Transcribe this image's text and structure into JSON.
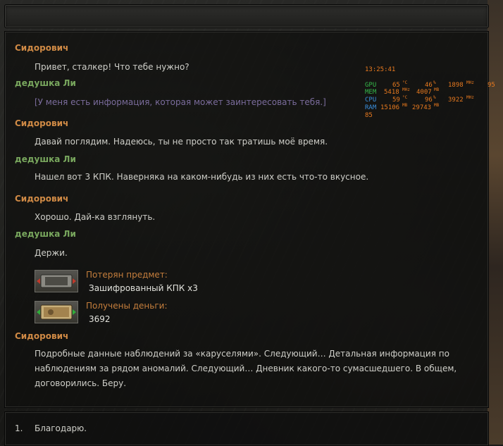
{
  "dialog": {
    "messages": [
      {
        "speaker": "Сидорович",
        "text": "Привет, сталкер! Что тебе нужно?"
      },
      {
        "speaker": "дедушка Ли",
        "text": "[У меня есть информация, которая может заинтересовать тебя.]"
      },
      {
        "speaker": "Сидорович",
        "text": "Давай поглядим. Надеюсь, ты не просто так тратишь моё время."
      },
      {
        "speaker": "дедушка Ли",
        "text": "Нашел вот 3 КПК. Наверняка на каком-нибудь из них есть что-то вкусное."
      },
      {
        "speaker": "Сидорович",
        "text": "Хорошо. Дай-ка взглянуть."
      },
      {
        "speaker": "дедушка Ли",
        "text": "Держи."
      },
      {
        "speaker": "Сидорович",
        "text": "Подробные данные наблюдений за «каруселями». Следующий… Детальная информация по наблюдениям за рядом аномалий. Следующий… Дневник какого-то сумасшедшего. В общем, договорились. Беру."
      }
    ],
    "item_lost": {
      "label": "Потерян предмет:",
      "value": "Зашифрованный КПК х3",
      "icon": "pda-icon"
    },
    "money_received": {
      "label": "Получены деньги:",
      "value": "3692",
      "icon": "money-icon"
    }
  },
  "answers": [
    {
      "number": "1.",
      "text": "Благодарю."
    }
  ],
  "overlay": {
    "time": "13:25:41",
    "gpu": {
      "label": "GPU",
      "temp": "65",
      "temp_unit": "°C",
      "load": "46",
      "load_unit": "%",
      "clock": "1898",
      "clock_unit": "MHz",
      "extra": "95"
    },
    "mem": {
      "label": "MEM",
      "clock": "5418",
      "clock_unit": "MHz",
      "used": "4007",
      "used_unit": "MB"
    },
    "cpu": {
      "label": "CPU",
      "temp": "59",
      "temp_unit": "°C",
      "load": "96",
      "load_unit": "%",
      "clock": "3922",
      "clock_unit": "MHz"
    },
    "ram": {
      "label": "RAM",
      "used": "15106",
      "used_unit": "MB",
      "total": "29743",
      "total_unit": "MB"
    },
    "fps": "85"
  },
  "colors": {
    "speaker_trader": "#d08a45",
    "speaker_player": "#79a85e",
    "text": "#cfcfc9",
    "action_text": "#7b6c9c",
    "item_label": "#c57e3c"
  }
}
